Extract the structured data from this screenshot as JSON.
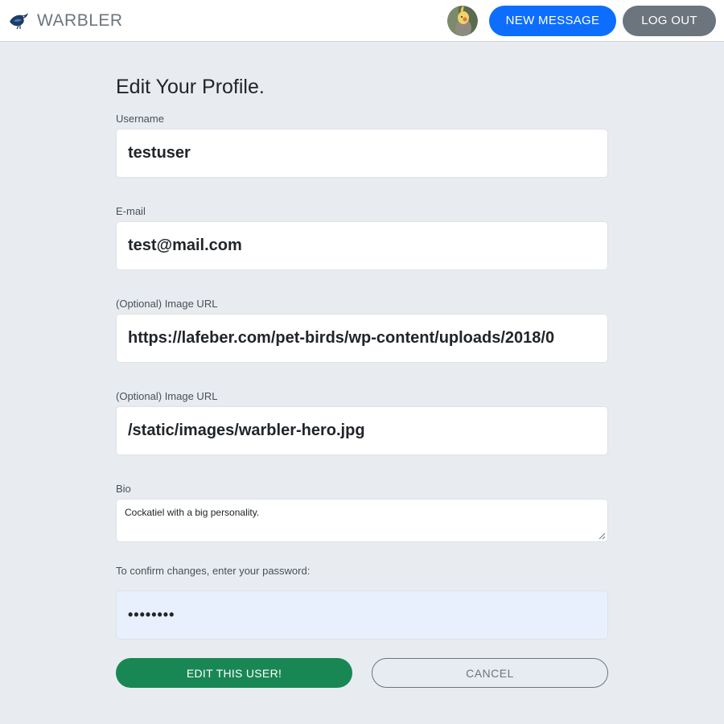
{
  "navbar": {
    "brand_name": "WARBLER",
    "logo_icon": "bird-logo-icon",
    "avatar_icon": "cockatiel-avatar",
    "new_message_label": "NEW MESSAGE",
    "logout_label": "LOG OUT"
  },
  "form": {
    "title": "Edit Your Profile.",
    "username": {
      "label": "Username",
      "value": "testuser"
    },
    "email": {
      "label": "E-mail",
      "value": "test@mail.com"
    },
    "image_url": {
      "label": "(Optional) Image URL",
      "value": "https://lafeber.com/pet-birds/wp-content/uploads/2018/0"
    },
    "header_image_url": {
      "label": "(Optional) Image URL",
      "value": "/static/images/warbler-hero.jpg"
    },
    "bio": {
      "label": "Bio",
      "value": "Cockatiel with a big personality."
    },
    "password": {
      "label": "To confirm changes, enter your password:",
      "value": "••••••••"
    },
    "submit_label": "EDIT THIS USER!",
    "cancel_label": "CANCEL"
  },
  "colors": {
    "primary": "#0d6efd",
    "secondary": "#6c757d",
    "success": "#198754",
    "background": "#e8ecf0",
    "autofill": "#e8f0fe"
  }
}
